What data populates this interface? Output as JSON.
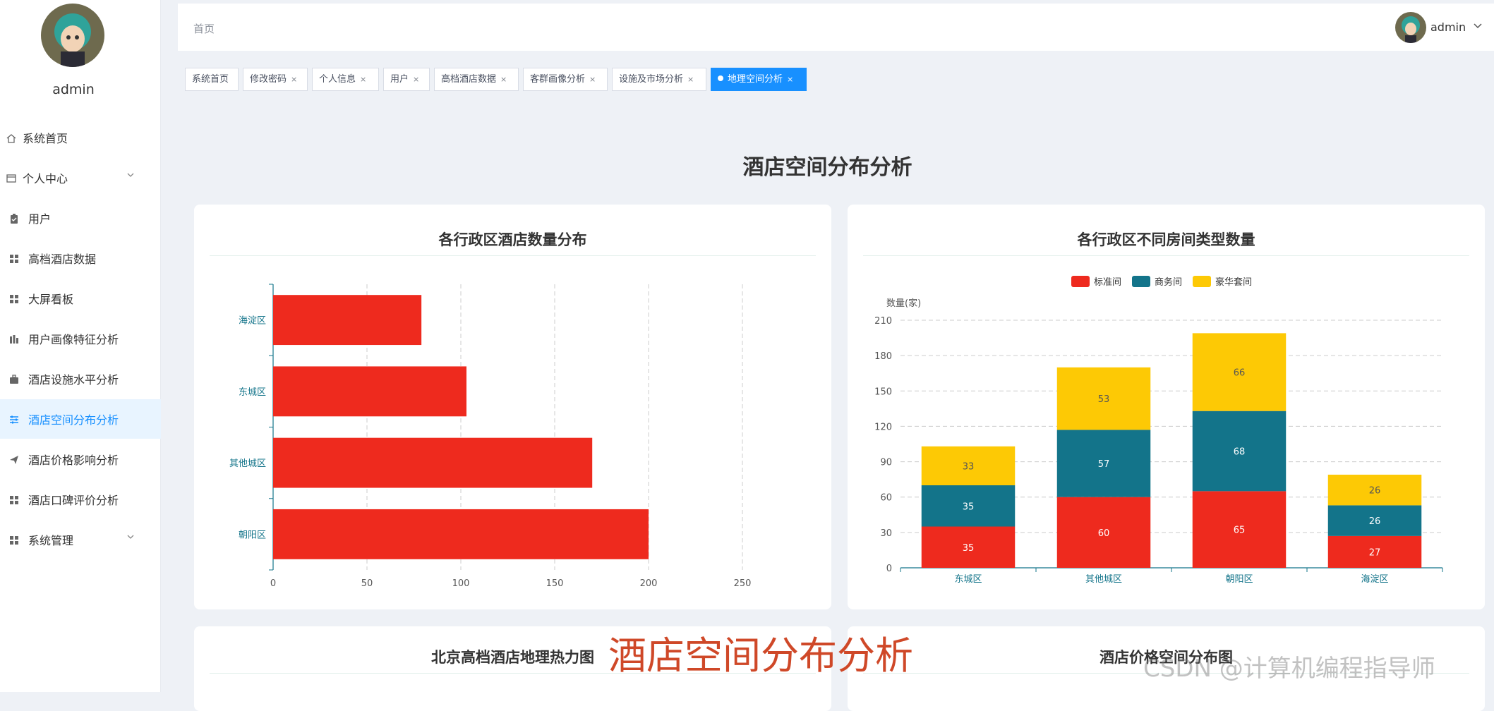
{
  "sidebar": {
    "username": "admin",
    "items": [
      {
        "label": "系统首页",
        "icon": "home-icon"
      },
      {
        "label": "个人中心",
        "icon": "person-card-icon",
        "expand": true
      },
      {
        "label": "用户",
        "icon": "clipboard-icon"
      },
      {
        "label": "高档酒店数据",
        "icon": "grid-icon"
      },
      {
        "label": "大屏看板",
        "icon": "grid-icon"
      },
      {
        "label": "用户画像特征分析",
        "icon": "bar-chart-icon"
      },
      {
        "label": "酒店设施水平分析",
        "icon": "briefcase-icon"
      },
      {
        "label": "酒店空间分布分析",
        "icon": "sliders-icon",
        "active": true
      },
      {
        "label": "酒店价格影响分析",
        "icon": "paper-plane-icon"
      },
      {
        "label": "酒店口碑评价分析",
        "icon": "grid-icon"
      },
      {
        "label": "系统管理",
        "icon": "grid-icon",
        "expand": true
      }
    ]
  },
  "topbar": {
    "breadcrumb": "首页",
    "username": "admin"
  },
  "tabs": [
    {
      "label": "系统首页",
      "closable": false
    },
    {
      "label": "修改密码",
      "closable": true
    },
    {
      "label": "个人信息",
      "closable": true
    },
    {
      "label": "用户",
      "closable": true
    },
    {
      "label": "高档酒店数据",
      "closable": true
    },
    {
      "label": "客群画像分析",
      "closable": true
    },
    {
      "label": "设施及市场分析",
      "closable": true
    },
    {
      "label": "地理空间分析",
      "closable": true,
      "active": true
    }
  ],
  "page_title": "酒店空间分布分析",
  "cards": {
    "hbar_title": "各行政区酒店数量分布",
    "stack_title": "各行政区不同房间类型数量",
    "heatmap_title": "北京高档酒店地理热力图",
    "price_title": "酒店价格空间分布图"
  },
  "overlay_text": "酒店空间分布分析",
  "watermark": "CSDN @计算机编程指导师",
  "colors": {
    "accent": "#1890ff",
    "red": "#ee2a1e",
    "teal": "#13748a",
    "yellow": "#fdc905"
  },
  "chart_data": [
    {
      "type": "bar",
      "orientation": "horizontal",
      "title": "各行政区酒店数量分布",
      "categories": [
        "海淀区",
        "东城区",
        "其他城区",
        "朝阳区"
      ],
      "values": [
        79,
        103,
        170,
        200
      ],
      "xlim": [
        0,
        250
      ],
      "xticks": [
        0,
        50,
        100,
        150,
        200,
        250
      ],
      "grid": "vertical dashed",
      "color": "#ee2a1e"
    },
    {
      "type": "bar",
      "stacked": true,
      "title": "各行政区不同房间类型数量",
      "ylabel": "数量(家)",
      "categories": [
        "东城区",
        "其他城区",
        "朝阳区",
        "海淀区"
      ],
      "series": [
        {
          "name": "标准间",
          "values": [
            35,
            60,
            65,
            27
          ],
          "color": "#ee2a1e"
        },
        {
          "name": "商务间",
          "values": [
            35,
            57,
            68,
            26
          ],
          "color": "#13748a"
        },
        {
          "name": "豪华套间",
          "values": [
            33,
            53,
            66,
            26
          ],
          "color": "#fdc905"
        }
      ],
      "ylim": [
        0,
        210
      ],
      "yticks": [
        0,
        30,
        60,
        90,
        120,
        150,
        180,
        210
      ],
      "legend": "top-center",
      "grid": "horizontal dashed"
    }
  ]
}
